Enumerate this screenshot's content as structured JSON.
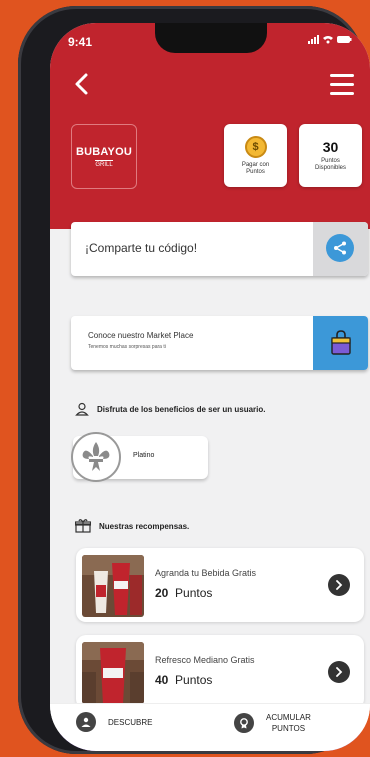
{
  "status_bar": {
    "time": "9:41",
    "icons": "signal-wifi-battery"
  },
  "header": {
    "back_icon": "back-arrow-icon",
    "menu_icon": "hamburger-menu-icon",
    "logo_text": "BUBAYOU",
    "logo_subtext": "GRILL",
    "pay_points": {
      "icon": "dollar-coin-icon",
      "label_line1": "Pagar con",
      "label_line2": "Puntos"
    },
    "available_points": {
      "value": "30",
      "label_line1": "Puntos",
      "label_line2": "Disponibles"
    }
  },
  "share": {
    "text": "¡Comparte tu código!",
    "icon": "share-icon"
  },
  "market": {
    "title": "Conoce nuestro Market Place",
    "subtitle": "Tenemos muchas sorpresas para ti",
    "icon": "shopping-bag-icon"
  },
  "benefits": {
    "title": "Disfruta de los beneficios de ser un usuario.",
    "level_name": "Platino",
    "level_icon": "fleur-de-lis-icon"
  },
  "rewards": {
    "title": "Nuestras recompensas.",
    "items": [
      {
        "title": "Agranda tu Bebida Gratis",
        "points": "20",
        "unit": "Puntos"
      },
      {
        "title": "Refresco Mediano Gratis",
        "points": "40",
        "unit": "Puntos"
      }
    ]
  },
  "bottom_nav": {
    "discover_label": "DESCUBRE",
    "accumulate_label_line1": "ACUMULAR",
    "accumulate_label_line2": "PUNTOS"
  },
  "colors": {
    "brand_red": "#c0242d",
    "accent_blue": "#3c98d8",
    "nav_purple": "#5e16c7",
    "background_orange": "#e0541f"
  }
}
